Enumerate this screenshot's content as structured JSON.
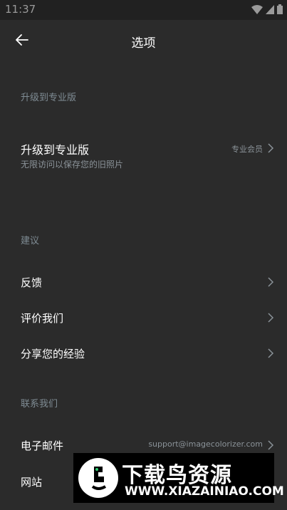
{
  "status_bar": {
    "time": "11:37",
    "icons": [
      "wifi-icon",
      "signal-icon",
      "battery-icon"
    ]
  },
  "header": {
    "title": "选项",
    "back_icon": "arrow-left-icon"
  },
  "sections": {
    "upgrade": {
      "header": "升级到专业版",
      "row": {
        "label": "升级到专业版",
        "subtitle": "无限访问以保存您的旧照片",
        "value": "专业会员"
      }
    },
    "suggestions": {
      "header": "建议",
      "items": [
        {
          "label": "反馈"
        },
        {
          "label": "评价我们"
        },
        {
          "label": "分享您的经验"
        }
      ]
    },
    "contact": {
      "header": "联系我们",
      "items": [
        {
          "label": "电子邮件",
          "value": "support@imagecolorizer.com"
        },
        {
          "label": "网站"
        }
      ]
    }
  },
  "watermark": {
    "name": "下载鸟资源",
    "url": "WWW.XIAZAINIAO.COM"
  },
  "colors": {
    "background": "#2b2b2b",
    "status_bar": "#212121",
    "section_header": "#7f8c94",
    "secondary_text": "#8b9399"
  }
}
